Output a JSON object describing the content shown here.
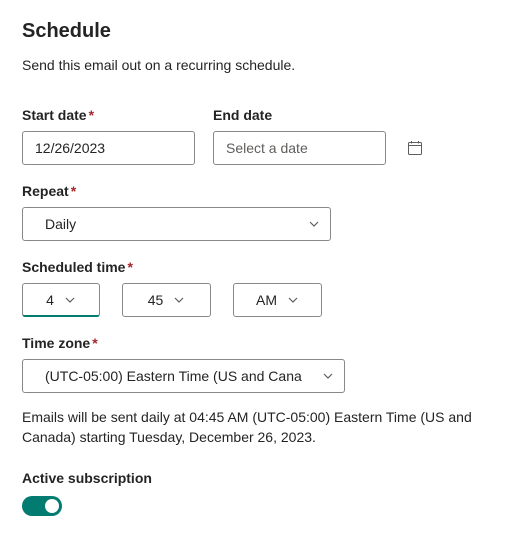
{
  "heading": "Schedule",
  "description": "Send this email out on a recurring schedule.",
  "labels": {
    "start_date": "Start date",
    "end_date": "End date",
    "repeat": "Repeat",
    "scheduled_time": "Scheduled time",
    "time_zone": "Time zone",
    "active_subscription": "Active subscription"
  },
  "start_date": {
    "value": "12/26/2023"
  },
  "end_date": {
    "placeholder": "Select a date"
  },
  "repeat": {
    "value": "Daily"
  },
  "time": {
    "hour": "4",
    "minute": "45",
    "period": "AM"
  },
  "timezone": {
    "value": "(UTC-05:00) Eastern Time (US and Cana"
  },
  "summary": "Emails will be sent daily at 04:45 AM (UTC-05:00) Eastern Time (US and Canada) starting Tuesday, December 26, 2023.",
  "active_subscription": true
}
